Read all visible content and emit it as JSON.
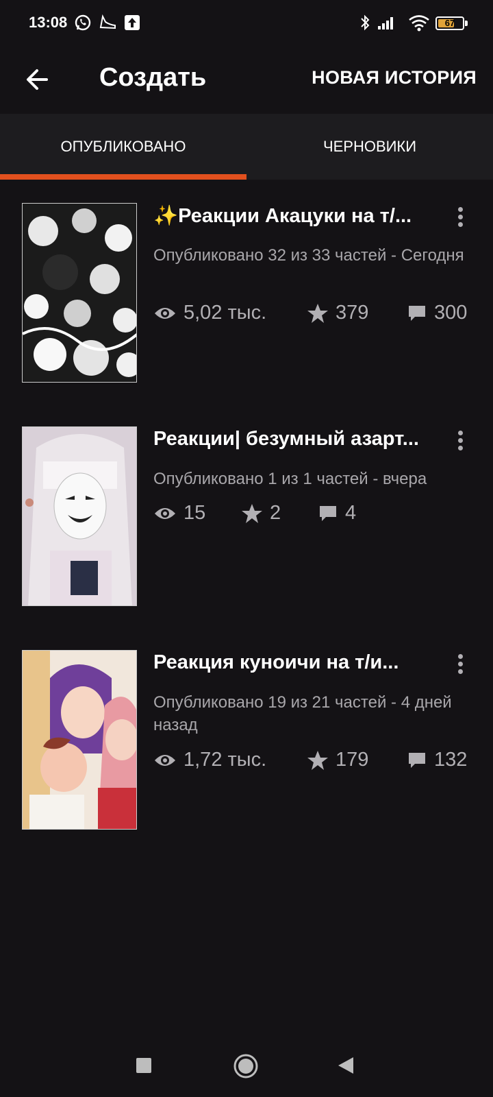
{
  "status_bar": {
    "time": "13:08",
    "battery": "67",
    "icons": [
      "whatsapp-icon",
      "sneaker-icon",
      "upload-icon",
      "bluetooth-icon",
      "signal-icon",
      "wifi-icon",
      "battery-icon"
    ]
  },
  "header": {
    "title": "Создать",
    "action_label": "НОВАЯ ИСТОРИЯ"
  },
  "tabs": [
    {
      "label": "ОПУБЛИКОВАНО",
      "active": true
    },
    {
      "label": "ЧЕРНОВИКИ",
      "active": false
    }
  ],
  "accent_color": "#e2501e",
  "stories": [
    {
      "title": "✨Реакции Акацуки на т/...",
      "meta": "Опубликовано 32 из 33 частей - Сегодня",
      "reads": "5,02 тыс.",
      "votes": "379",
      "comments": "300"
    },
    {
      "title": "Реакции| безумный азарт...",
      "meta": "Опубликовано 1 из 1 частей - вчера",
      "reads": "15",
      "votes": "2",
      "comments": "4"
    },
    {
      "title": "Реакция куноичи на т/и...",
      "meta": "Опубликовано 19 из 21 частей - 4 дней назад",
      "reads": "1,72 тыс.",
      "votes": "179",
      "comments": "132"
    }
  ]
}
